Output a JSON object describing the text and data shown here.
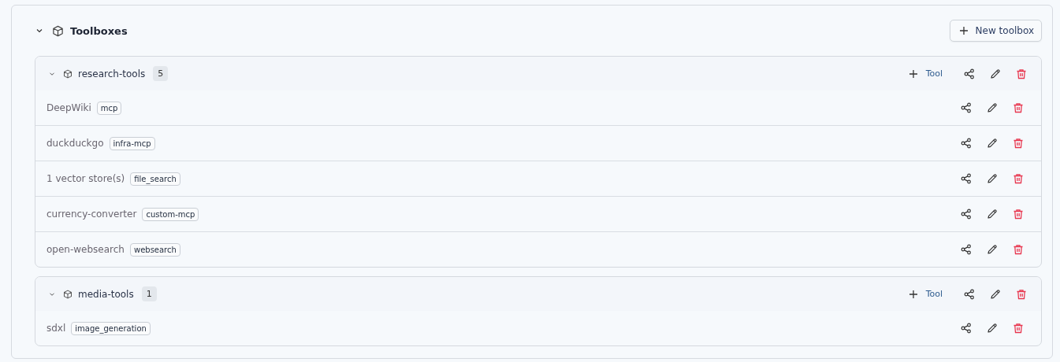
{
  "section": {
    "title": "Toolboxes",
    "expanded": true,
    "new_button": "New toolbox"
  },
  "toolboxes": [
    {
      "name": "research-tools",
      "count": "5",
      "expanded": true,
      "add_button": "Tool",
      "tools": [
        {
          "name": "DeepWiki",
          "tag": "mcp"
        },
        {
          "name": "duckduckgo",
          "tag": "infra-mcp"
        },
        {
          "name": "1 vector store(s)",
          "tag": "file_search"
        },
        {
          "name": "currency-converter",
          "tag": "custom-mcp"
        },
        {
          "name": "open-websearch",
          "tag": "websearch"
        }
      ]
    },
    {
      "name": "media-tools",
      "count": "1",
      "expanded": true,
      "add_button": "Tool",
      "tools": [
        {
          "name": "sdxl",
          "tag": "image_generation"
        }
      ]
    }
  ]
}
